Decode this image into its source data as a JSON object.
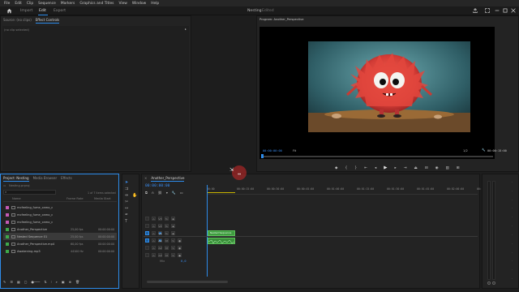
{
  "menubar": {
    "items": [
      "File",
      "Edit",
      "Clip",
      "Sequence",
      "Markers",
      "Graphics and Titles",
      "View",
      "Window",
      "Help"
    ]
  },
  "workspace": {
    "home_icon": "home-icon",
    "tabs": [
      "Import",
      "Edit",
      "Export"
    ],
    "active_tab": "Edit",
    "center_title": "Nesting",
    "center_sub": "Edited",
    "right_icons": [
      "share-icon",
      "maximize-icon",
      "minimize-icon",
      "restore-icon",
      "close-icon"
    ]
  },
  "source_panel": {
    "tabs": [
      "Source: (no clips)",
      "Effect Controls"
    ],
    "selected_tab": "Effect Controls",
    "no_clip_text": "(no clip selected)"
  },
  "program_monitor": {
    "title": "Program: Another_Perspective",
    "timecode_current": "00:00:00:00",
    "fit": "Fit",
    "resolution": "1/2",
    "timecode_duration": "00:00:15:00"
  },
  "project_panel": {
    "tabs": [
      "Project: Nesting",
      "Media Browser",
      "Effects"
    ],
    "selected_tab": "Project: Nesting",
    "project_file": "Nesting.prproj",
    "items_selected": "1 of 7 items selected",
    "columns": [
      "Name",
      "Frame Rate",
      "Media Start"
    ],
    "rows": [
      {
        "color": "#c45ab5",
        "name": "mcfeeling_fume_camo_c",
        "rate": "",
        "start": ""
      },
      {
        "color": "#c45ab5",
        "name": "mcfeeling_fume_camo_c",
        "rate": "",
        "start": ""
      },
      {
        "color": "#c45ab5",
        "name": "mcfeeling_fume_camo_c",
        "rate": "",
        "start": ""
      },
      {
        "color": "#3fa84a",
        "name": "Another_Perspective",
        "rate": "25,00 fps",
        "start": "00:00:00:00"
      },
      {
        "color": "#3fa84a",
        "name": "Nested Sequence 01",
        "rate": "25,00 fps",
        "start": "00:00:00:00",
        "selected": true
      },
      {
        "color": "#3fa84a",
        "name": "Another_Perspective.mp4",
        "rate": "60,00 fps",
        "start": "00:00:00:00"
      },
      {
        "color": "#3fa84a",
        "name": "Awakening.mp3",
        "rate": "44100 Hz",
        "start": "00:00:00:00"
      }
    ]
  },
  "timeline": {
    "sequence_tab": "Another_Perspective",
    "timecode": "00:00:00:00",
    "ruler": [
      "00:00",
      "00:00:15:00",
      "00:00:30:00",
      "00:00:45:00",
      "00:01:00:00",
      "00:01:15:00",
      "00:01:30:00",
      "00:01:45:00",
      "00:02:00:00",
      "00:02:15:00"
    ],
    "video_tracks": [
      "V3",
      "V2",
      "V1"
    ],
    "audio_tracks": [
      "A1",
      "A2",
      "A3"
    ],
    "mix_label": "Mix",
    "mix_value": "0,0",
    "clip_label": "Nested Sequence"
  },
  "accent": "#2d8ceb"
}
